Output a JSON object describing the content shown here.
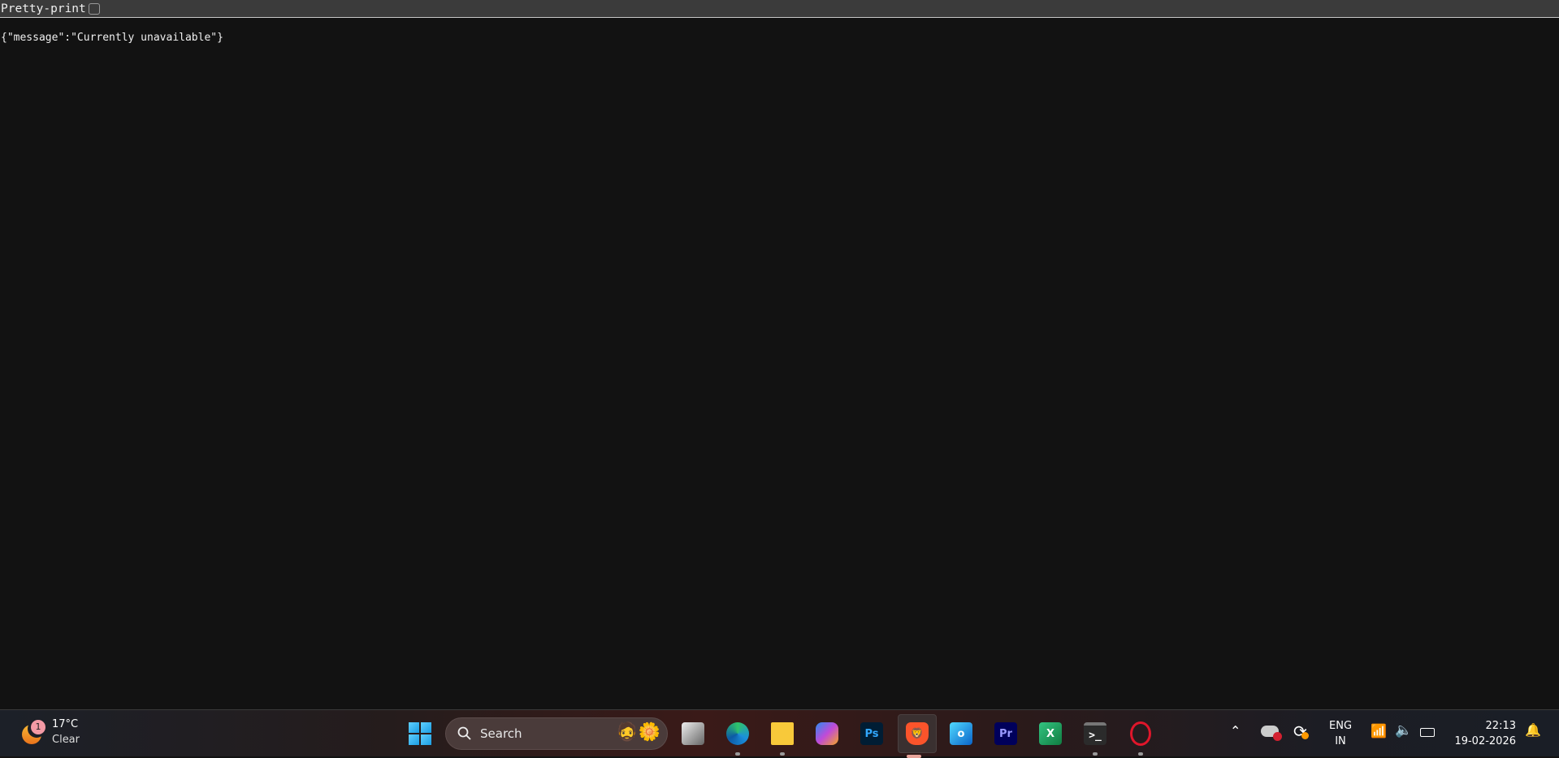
{
  "toolbar": {
    "pretty_print_label": "Pretty-print",
    "pretty_print_checked": false
  },
  "content": {
    "json_text": "{\"message\":\"Currently unavailable\"}"
  },
  "taskbar": {
    "weather": {
      "badge": "1",
      "temperature": "17°C",
      "condition": "Clear"
    },
    "search": {
      "label": "Search"
    },
    "apps": [
      {
        "name": "Task View",
        "icon": "task-view-icon"
      },
      {
        "name": "Microsoft Edge",
        "icon": "edge-icon",
        "running": true
      },
      {
        "name": "File Explorer",
        "icon": "folder-icon",
        "running": true
      },
      {
        "name": "Copilot",
        "icon": "copilot-icon"
      },
      {
        "name": "Photoshop",
        "icon": "photoshop-icon",
        "text": "Ps"
      },
      {
        "name": "Brave",
        "icon": "brave-icon",
        "active": true
      },
      {
        "name": "Outlook",
        "icon": "outlook-icon"
      },
      {
        "name": "Premiere Pro",
        "icon": "premiere-icon",
        "text": "Pr"
      },
      {
        "name": "Excel",
        "icon": "excel-icon",
        "text": "X"
      },
      {
        "name": "Terminal",
        "icon": "terminal-icon",
        "running": true
      },
      {
        "name": "Opera",
        "icon": "opera-icon",
        "running": true
      }
    ],
    "tray": {
      "language_line1": "ENG",
      "language_line2": "IN",
      "time": "22:13",
      "date": "19-02-2026"
    }
  }
}
